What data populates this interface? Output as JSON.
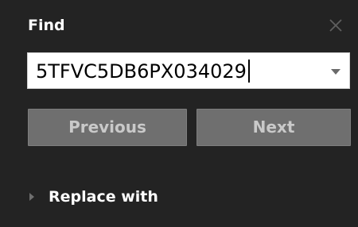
{
  "panel": {
    "title": "Find",
    "close_icon": "close-icon"
  },
  "find": {
    "value": "5TFVC5DB6PX034029",
    "dropdown_icon": "chevron-down-icon"
  },
  "buttons": {
    "previous_label": "Previous",
    "next_label": "Next"
  },
  "replace": {
    "label": "Replace with",
    "expand_icon": "caret-right-icon"
  },
  "colors": {
    "background": "#232323",
    "button_bg": "#6f6f6f",
    "button_text": "#c9c9c9",
    "input_bg": "#ffffff"
  }
}
